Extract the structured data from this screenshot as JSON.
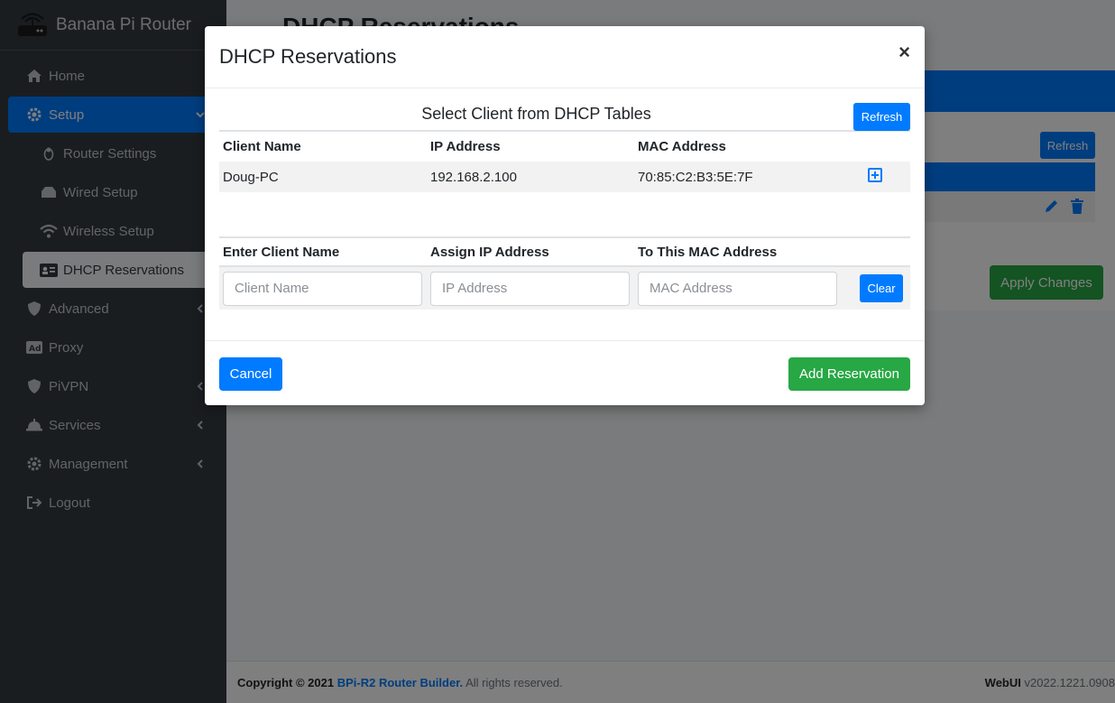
{
  "app": {
    "brand": "Banana Pi Router",
    "page_title": "DHCP Reservations"
  },
  "sidebar": {
    "items": [
      {
        "label": "Home",
        "icon": "home-icon"
      },
      {
        "label": "Setup",
        "icon": "gear-icon"
      },
      {
        "label": "Router Settings",
        "icon": "linux-icon"
      },
      {
        "label": "Wired Setup",
        "icon": "network-icon"
      },
      {
        "label": "Wireless Setup",
        "icon": "wifi-icon"
      },
      {
        "label": "DHCP Reservations",
        "icon": "id-card-icon"
      },
      {
        "label": "Advanced",
        "icon": "shield-icon"
      },
      {
        "label": "Proxy",
        "icon": "ad-icon"
      },
      {
        "label": "PiVPN",
        "icon": "shield-icon"
      },
      {
        "label": "Services",
        "icon": "bell-icon"
      },
      {
        "label": "Management",
        "icon": "gear-icon"
      },
      {
        "label": "Logout",
        "icon": "logout-icon"
      }
    ]
  },
  "background": {
    "refresh_label": "Refresh",
    "apply_label": "Apply Changes"
  },
  "footer": {
    "copyright_prefix": "Copyright © 2021",
    "link_text": "BPi-R2 Router Builder.",
    "rights": "All rights reserved.",
    "version_label": "WebUI",
    "version": "v2022.1221.0908"
  },
  "modal": {
    "title": "DHCP Reservations",
    "close_label": "×",
    "select_title": "Select Client from DHCP Tables",
    "refresh_label": "Refresh",
    "client_table": {
      "headers": [
        "Client Name",
        "IP Address",
        "MAC Address"
      ],
      "rows": [
        {
          "name": "Doug-PC",
          "ip": "192.168.2.100",
          "mac": "70:85:C2:B3:5E:7F"
        }
      ]
    },
    "entry": {
      "headers": [
        "Enter Client Name",
        "Assign IP Address",
        "To This MAC Address"
      ],
      "name_placeholder": "Client Name",
      "ip_placeholder": "IP Address",
      "mac_placeholder": "MAC Address",
      "clear_label": "Clear"
    },
    "cancel_label": "Cancel",
    "add_label": "Add Reservation"
  },
  "colors": {
    "primary": "#007bff",
    "success": "#28a745",
    "sidebar": "#343a40"
  }
}
